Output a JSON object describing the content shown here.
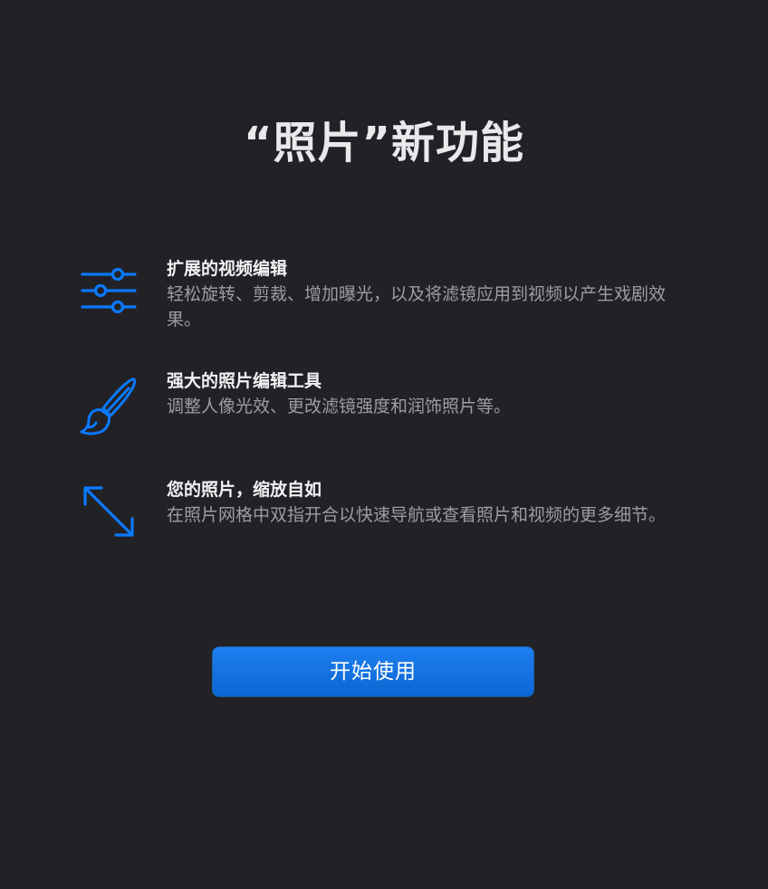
{
  "page": {
    "title": "“照片”新功能"
  },
  "features": [
    {
      "icon": "sliders-icon",
      "title": "扩展的视频编辑",
      "description": "轻松旋转、剪裁、增加曝光，以及将滤镜应用到视频以产生戏剧效果。"
    },
    {
      "icon": "paintbrush-icon",
      "title": "强大的照片编辑工具",
      "description": "调整人像光效、更改滤镜强度和润饰照片等。"
    },
    {
      "icon": "expand-arrows-icon",
      "title": "您的照片，缩放自如",
      "description": "在照片网格中双指开合以快速导航或查看照片和视频的更多细节。"
    }
  ],
  "actions": {
    "start_label": "开始使用"
  },
  "colors": {
    "background": "#222126",
    "accent": "#0a7aff",
    "button": "#0a66d2",
    "secondary_text": "#9c9ca2"
  }
}
